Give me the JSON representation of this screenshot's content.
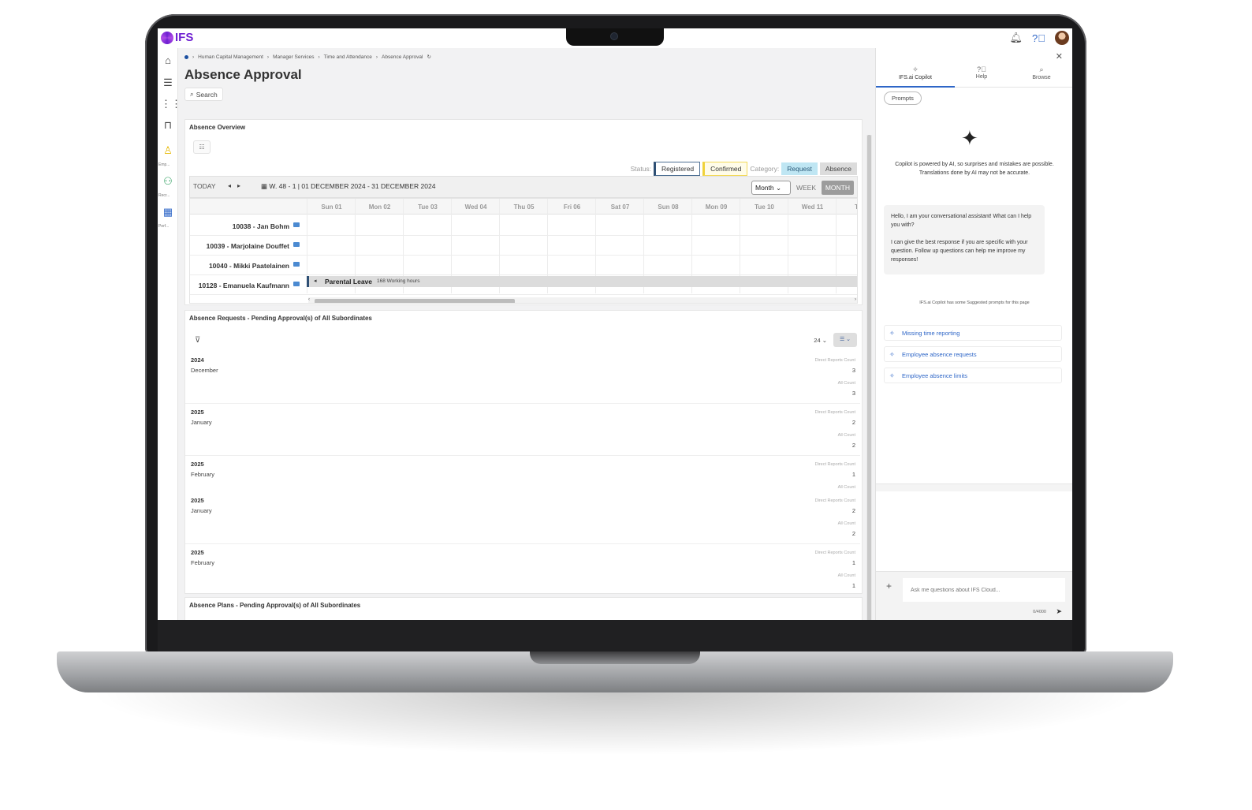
{
  "app": {
    "logo": "IFS"
  },
  "topbar": {
    "bell_icon": "bell-icon",
    "help_icon": "help-icon"
  },
  "leftnav": {
    "items": [
      {
        "icon": "home-icon",
        "glyph": "⌂"
      },
      {
        "icon": "menu-icon",
        "glyph": "☰"
      },
      {
        "icon": "apps-icon",
        "glyph": "⋮⋮"
      },
      {
        "icon": "bookmark-icon",
        "glyph": "⊓"
      }
    ],
    "subs": [
      "Emp...",
      "Recr...",
      "Perf..."
    ]
  },
  "breadcrumb": [
    "Human Capital Management",
    "Manager Services",
    "Time and Attendance",
    "Absence Approval"
  ],
  "page": {
    "title": "Absence Approval",
    "search_label": "Search"
  },
  "overview": {
    "title": "Absence Overview",
    "status_label": "Status:",
    "status_registered": "Registered",
    "status_confirmed": "Confirmed",
    "category_label": "Category:",
    "category_request": "Request",
    "category_absence": "Absence",
    "today": "TODAY",
    "week_range": "W. 48 - 1 | 01 DECEMBER 2024 - 31 DECEMBER 2024",
    "view_select": "Month",
    "week_btn": "WEEK",
    "month_btn": "MONTH",
    "days": [
      "Sun 01",
      "Mon 02",
      "Tue 03",
      "Wed 04",
      "Thu 05",
      "Fri 06",
      "Sat 07",
      "Sun 08",
      "Mon 09",
      "Tue 10",
      "Wed 11",
      "Thu"
    ],
    "employees": [
      "10038 - Jan Bohm",
      "10039 - Marjolaine Douffet",
      "10040 - Mikki Paatelainen",
      "10128 - Emanuela Kaufmann"
    ],
    "leave": {
      "title": "Parental Leave",
      "hours": "168 Working hours"
    }
  },
  "requests": {
    "title": "Absence Requests - Pending Approval(s) of All Subordinates",
    "page_size": "24",
    "direct_label": "Direct Reports Count",
    "all_label": "All Count",
    "groups": [
      {
        "year": "2024",
        "month": "December",
        "direct": "3",
        "all": "3"
      },
      {
        "year": "2025",
        "month": "January",
        "direct": "2",
        "all": "2"
      },
      {
        "year": "2025",
        "month": "February",
        "direct": "1",
        "all": ""
      },
      {
        "year": "2025",
        "month": "January",
        "direct": "2",
        "all": "2"
      },
      {
        "year": "2025",
        "month": "February",
        "direct": "1",
        "all": "1"
      }
    ]
  },
  "plans": {
    "title": "Absence Plans - Pending Approval(s) of All Subordinates"
  },
  "copilot": {
    "tabs": [
      "IFS.ai Copilot",
      "Help",
      "Browse"
    ],
    "prompts_btn": "Prompts",
    "note1": "Copilot is powered by AI, so surprises and mistakes are possible.",
    "note2": "Translations done by AI may not be accurate.",
    "greeting1": "Hello, I am your conversational assistant! What can I help you with?",
    "greeting2": "I can give the best response if you are specific with your question. Follow up questions can help me improve my responses!",
    "suggested_label": "IFS.ai Copilot has some Suggested prompts for this page",
    "prompts": [
      "Missing time reporting",
      "Employee absence requests",
      "Employee absence limits"
    ],
    "input_placeholder": "Ask me questions about IFS Cloud...",
    "char_count": "0/4000"
  }
}
